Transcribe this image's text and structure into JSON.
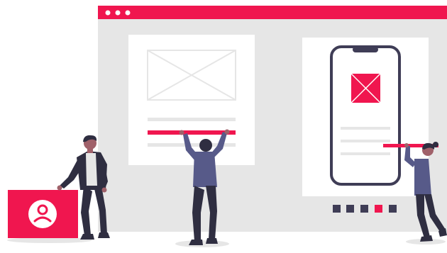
{
  "illustration": {
    "theme": "ui-design-wireframe",
    "colors": {
      "accent": "#f0164f",
      "browser_body": "#e6e6e6",
      "card": "#ffffff",
      "wire_line": "#e6e6e6",
      "device_frame": "#3f3d56",
      "figure_dark": "#2f2e41",
      "shirt_blue": "#575a89",
      "shirt_light": "#e6e6e6",
      "skin": "#a0616a",
      "hair": "#2f2e41"
    },
    "browser_window": {
      "dots": [
        "dot-1",
        "dot-2",
        "dot-3"
      ]
    },
    "pagination": {
      "count": 5,
      "active_index": 3
    },
    "icons": {
      "profile": "user-circle-icon",
      "image_placeholder": "image-placeholder-icon"
    }
  }
}
